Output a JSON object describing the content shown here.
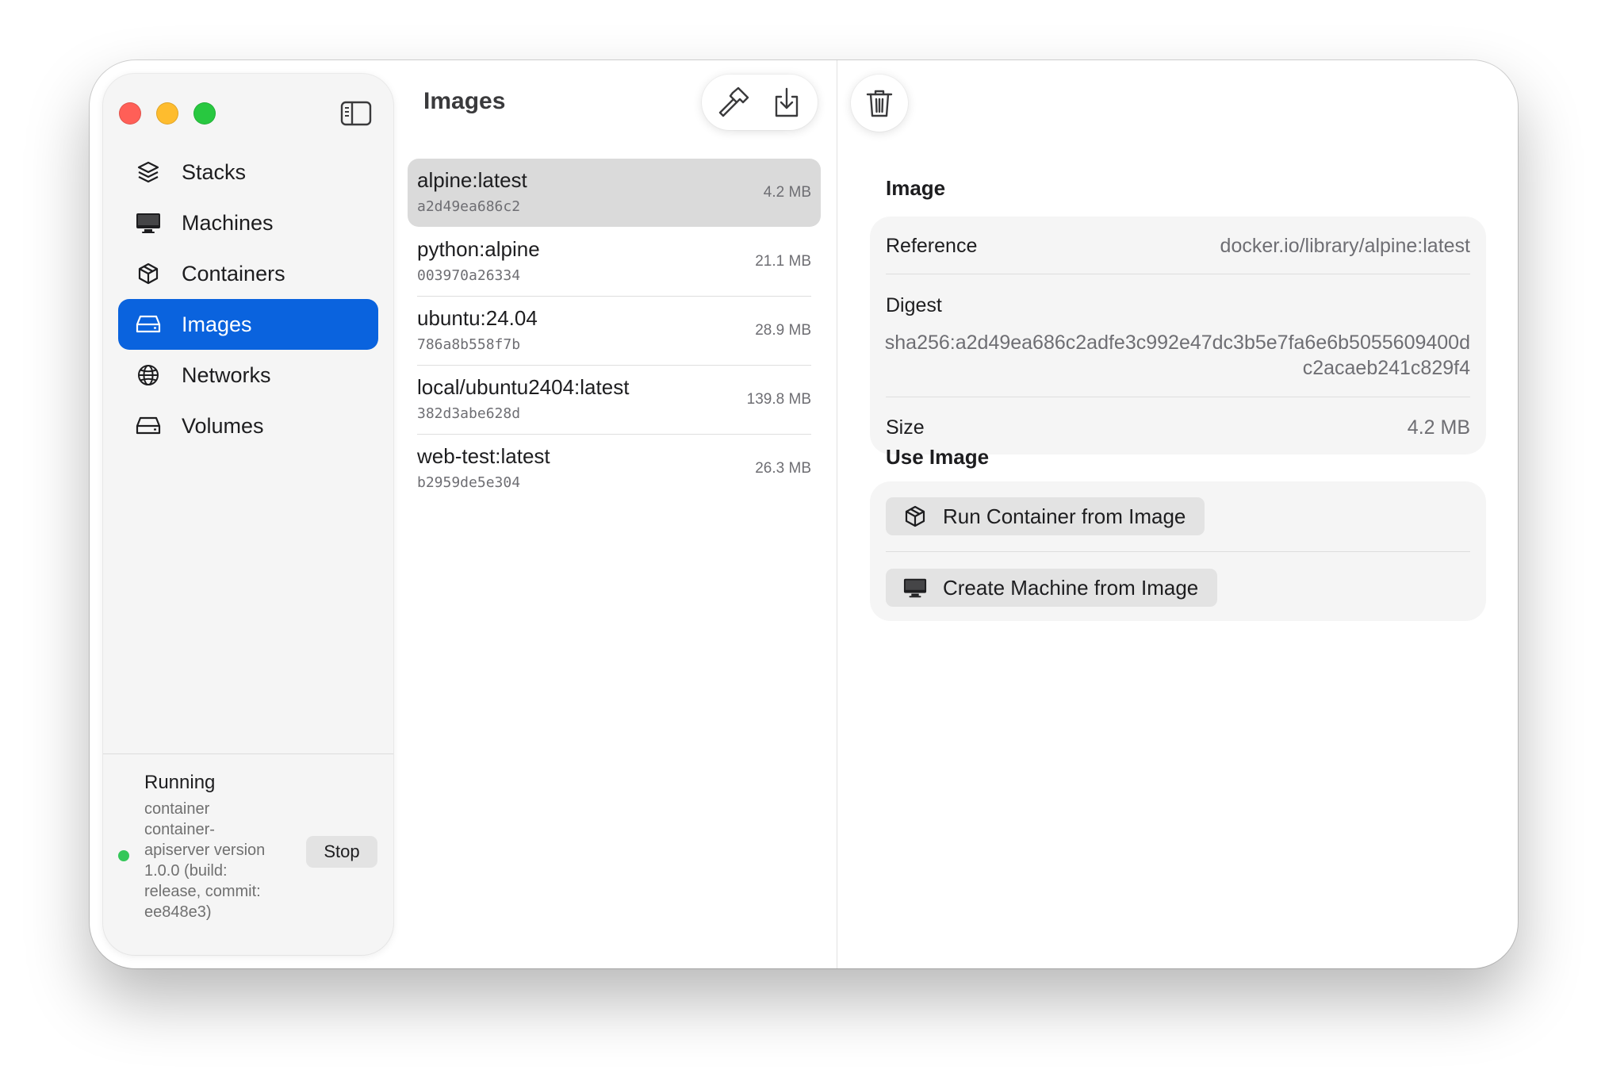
{
  "sidebar": {
    "items": [
      {
        "label": "Stacks",
        "icon": "stack-icon",
        "active": false
      },
      {
        "label": "Machines",
        "icon": "desktop-icon",
        "active": false
      },
      {
        "label": "Containers",
        "icon": "cube-icon",
        "active": false
      },
      {
        "label": "Images",
        "icon": "drive-icon",
        "active": true
      },
      {
        "label": "Networks",
        "icon": "globe-icon",
        "active": false
      },
      {
        "label": "Volumes",
        "icon": "drive-icon",
        "active": false
      }
    ],
    "status": {
      "title": "Running",
      "detail": "container container-apiserver version 1.0.0 (build: release, commit: ee848e3)",
      "stop_label": "Stop",
      "dot_color": "#34c759"
    }
  },
  "list": {
    "title": "Images",
    "images": [
      {
        "name": "alpine:latest",
        "id": "a2d49ea686c2",
        "size": "4.2 MB",
        "selected": true
      },
      {
        "name": "python:alpine",
        "id": "003970a26334",
        "size": "21.1 MB",
        "selected": false
      },
      {
        "name": "ubuntu:24.04",
        "id": "786a8b558f7b",
        "size": "28.9 MB",
        "selected": false
      },
      {
        "name": "local/ubuntu2404:latest",
        "id": "382d3abe628d",
        "size": "139.8 MB",
        "selected": false
      },
      {
        "name": "web-test:latest",
        "id": "b2959de5e304",
        "size": "26.3 MB",
        "selected": false
      }
    ]
  },
  "detail": {
    "image_section_title": "Image",
    "reference_label": "Reference",
    "reference_value": "docker.io/library/alpine:latest",
    "digest_label": "Digest",
    "digest_value": "sha256:a2d49ea686c2adfe3c992e47dc3b5e7fa6e6b5055609400dc2acaeb241c829f4",
    "size_label": "Size",
    "size_value": "4.2 MB",
    "use_section_title": "Use Image",
    "run_container_label": "Run Container from Image",
    "create_machine_label": "Create Machine from Image"
  },
  "colors": {
    "accent": "#0a63de",
    "traffic_red": "#ff5f57",
    "traffic_yellow": "#febc2e",
    "traffic_green": "#28c840"
  }
}
